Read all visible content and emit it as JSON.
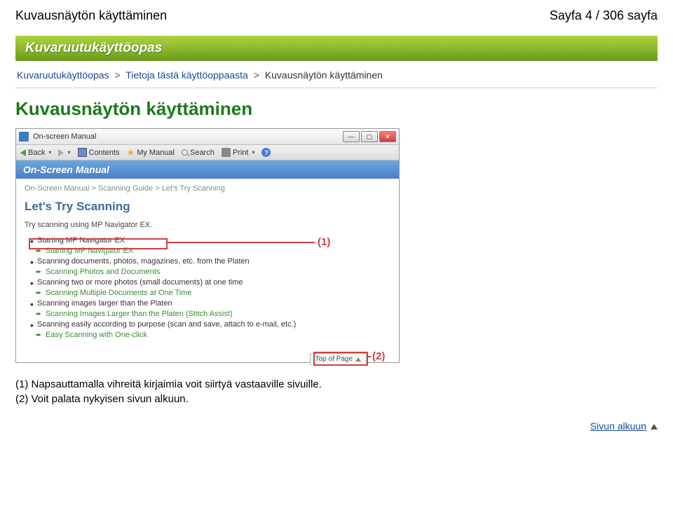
{
  "page": {
    "title_left": "Kuvausnäytön käyttäminen",
    "title_right": "Sayfa 4 / 306 sayfa"
  },
  "banner": "Kuvaruutukäyttöopas",
  "breadcrumb": {
    "a": "Kuvaruutukäyttöopas",
    "b": "Tietoja tästä käyttöoppaasta",
    "c": "Kuvausnäytön käyttäminen",
    "sep": ">"
  },
  "heading": "Kuvausnäytön käyttäminen",
  "shot": {
    "titlebar": "On-screen Manual",
    "toolbar": {
      "back": "Back",
      "contents": "Contents",
      "mymanual": "My Manual",
      "search": "Search",
      "print": "Print"
    },
    "subhead": "On-Screen Manual",
    "crumb": "On-Screen Manual > Scanning Guide > Let's Try Scanning",
    "h1": "Let's Try Scanning",
    "intro": "Try scanning using MP Navigator EX.",
    "items": [
      {
        "t": "Starting MP Navigator EX",
        "s": "Starting MP Navigator EX"
      },
      {
        "t": "Scanning documents, photos, magazines, etc. from the Platen",
        "s": "Scanning Photos and Documents"
      },
      {
        "t": "Scanning two or more photos (small documents) at one time",
        "s": "Scanning Multiple Documents at One Time"
      },
      {
        "t": "Scanning images larger than the Platen",
        "s": "Scanning Images Larger than the Platen (Stitch Assist)"
      },
      {
        "t": "Scanning easily according to purpose (scan and save, attach to e-mail, etc.)",
        "s": "Easy Scanning with One-click"
      }
    ],
    "topofpage": "Top of Page",
    "marker1": "(1)",
    "marker2": "(2)"
  },
  "notes": {
    "n1": "(1) Napsauttamalla vihreitä kirjaimia voit siirtyä vastaaville sivuille.",
    "n2": "(2) Voit palata nykyisen sivun alkuun."
  },
  "footer": "Sivun alkuun"
}
